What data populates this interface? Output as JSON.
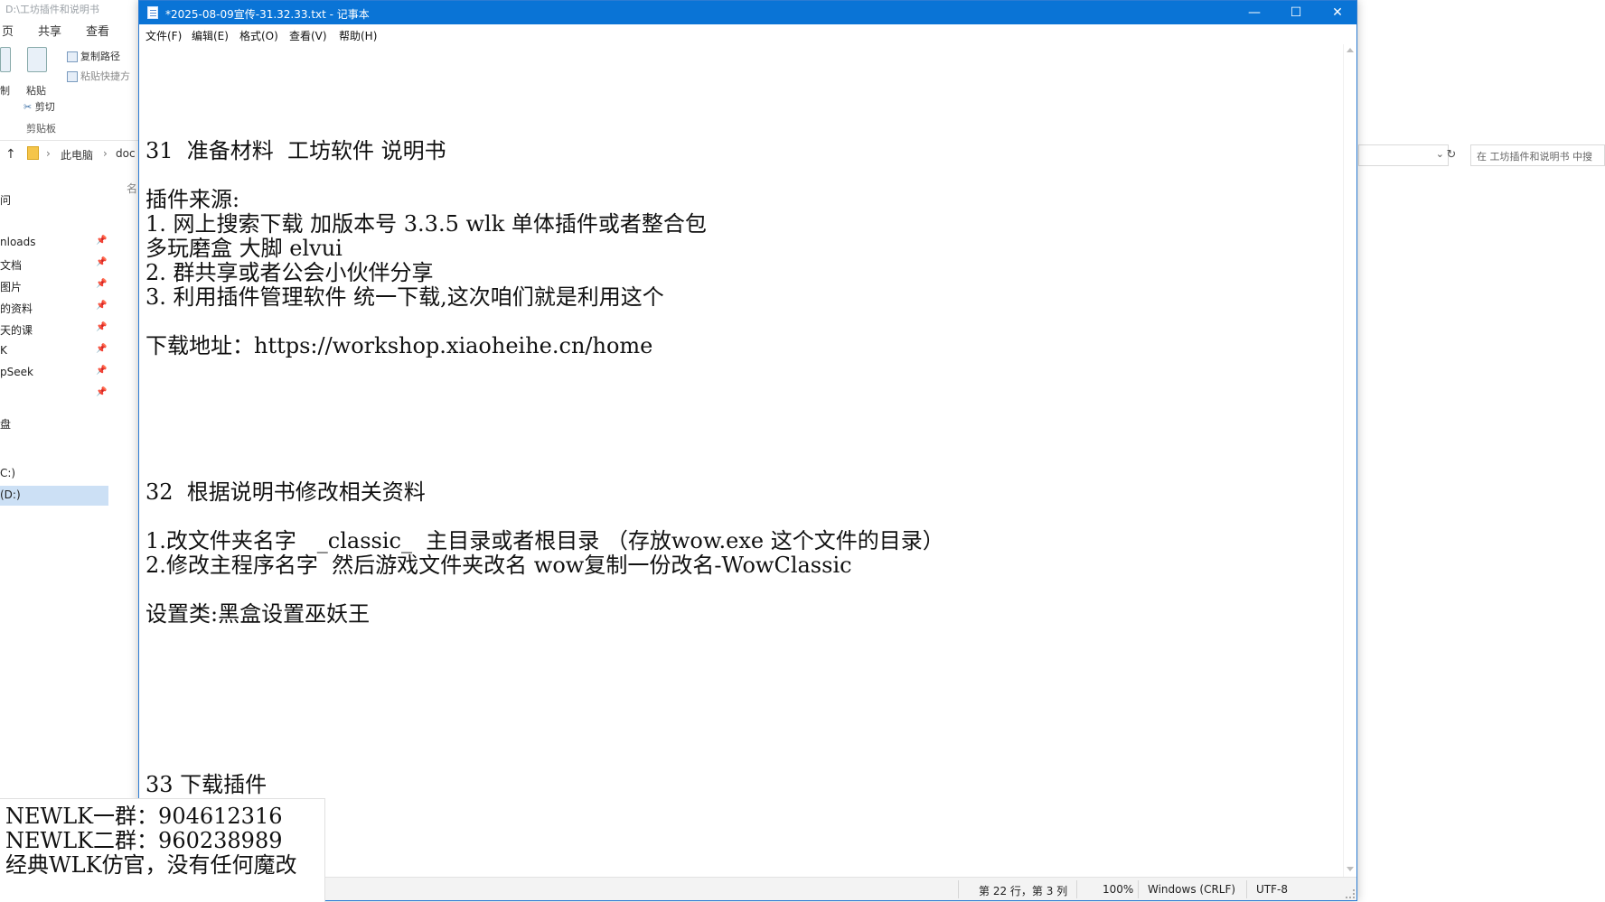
{
  "explorer": {
    "title": "D:\\工坊插件和说明书",
    "tabs": [
      "页",
      "共享",
      "查看"
    ],
    "ribbon": {
      "copy_label": "制",
      "paste_label": "粘贴",
      "copy_path": "复制路径",
      "paste_shortcut": "粘贴快捷方",
      "cut": "剪切",
      "clipboard_group": "剪贴板"
    },
    "address": {
      "segment1": "此电脑",
      "segment2": "doc",
      "col_header": "名"
    },
    "nav_items": [
      {
        "label": "问",
        "pinned": false
      },
      {
        "label": "nloads",
        "pinned": true
      },
      {
        "label": "文档",
        "pinned": true
      },
      {
        "label": "图片",
        "pinned": true
      },
      {
        "label": "的资料",
        "pinned": true
      },
      {
        "label": "天的课",
        "pinned": true
      },
      {
        "label": "K",
        "pinned": true
      },
      {
        "label": "pSeek",
        "pinned": true
      },
      {
        "label": "",
        "pinned": true
      },
      {
        "label": "盘",
        "pinned": false
      },
      {
        "label": "",
        "pinned": false
      },
      {
        "label": "C:)",
        "pinned": false
      },
      {
        "label": "(D:)",
        "pinned": false
      }
    ],
    "search_placeholder": "在 工坊插件和说明书 中搜"
  },
  "notepad": {
    "title": "*2025-08-09宣传-31.32.33.txt - 记事本",
    "menu": [
      "文件(F)",
      "编辑(E)",
      "格式(O)",
      "查看(V)",
      "帮助(H)"
    ],
    "window_buttons": {
      "minimize": "—",
      "maximize": "☐",
      "close": "✕"
    },
    "content_lines": [
      {
        "line": 1,
        "text": ""
      },
      {
        "line": 2,
        "text": ""
      },
      {
        "line": 3,
        "text": ""
      },
      {
        "line": 4,
        "text": "31  准备材料  工坊软件 说明书"
      },
      {
        "line": 5,
        "text": ""
      },
      {
        "line": 6,
        "text": "插件来源:"
      },
      {
        "line": 7,
        "text": "1. 网上搜索下载 加版本号 3.3.5 wlk 单体插件或者整合包"
      },
      {
        "line": 8,
        "text": "多玩磨盒 大脚 elvui"
      },
      {
        "line": 9,
        "text": "2. 群共享或者公会小伙伴分享"
      },
      {
        "line": 10,
        "text": "3. 利用插件管理软件 统一下载,这次咱们就是利用这个"
      },
      {
        "line": 11,
        "text": ""
      },
      {
        "line": 12,
        "text": "下载地址：https://workshop.xiaoheihe.cn/home"
      },
      {
        "line": 13,
        "text": ""
      },
      {
        "line": 14,
        "text": ""
      },
      {
        "line": 15,
        "text": ""
      },
      {
        "line": 16,
        "text": ""
      },
      {
        "line": 17,
        "text": ""
      },
      {
        "line": 18,
        "text": "32  根据说明书修改相关资料"
      },
      {
        "line": 19,
        "text": ""
      },
      {
        "line": 20,
        "text": "1.改文件夹名字   _classic_  主目录或者根目录 （存放wow.exe 这个文件的目录）"
      },
      {
        "line": 21,
        "text": "2.修改主程序名字  然后游戏文件夹改名 wow复制一份改名-WowClassic"
      },
      {
        "line": 22,
        "text": ""
      },
      {
        "line": 23,
        "text": "设置类:黑盒设置巫妖王"
      },
      {
        "line": 24,
        "text": ""
      },
      {
        "line": 25,
        "text": ""
      },
      {
        "line": 26,
        "text": ""
      },
      {
        "line": 27,
        "text": ""
      },
      {
        "line": 28,
        "text": ""
      },
      {
        "line": 29,
        "text": ""
      },
      {
        "line": 30,
        "text": "33 下载插件"
      }
    ],
    "status": {
      "position": "第 22 行，第 3 列",
      "zoom": "100%",
      "line_ending": "Windows (CRLF)",
      "encoding": "UTF-8"
    }
  },
  "overlay": {
    "lines": [
      "NEWLK一群：904612316",
      "NEWLK二群：960238989",
      "经典WLK仿官，没有任何魔改"
    ]
  }
}
